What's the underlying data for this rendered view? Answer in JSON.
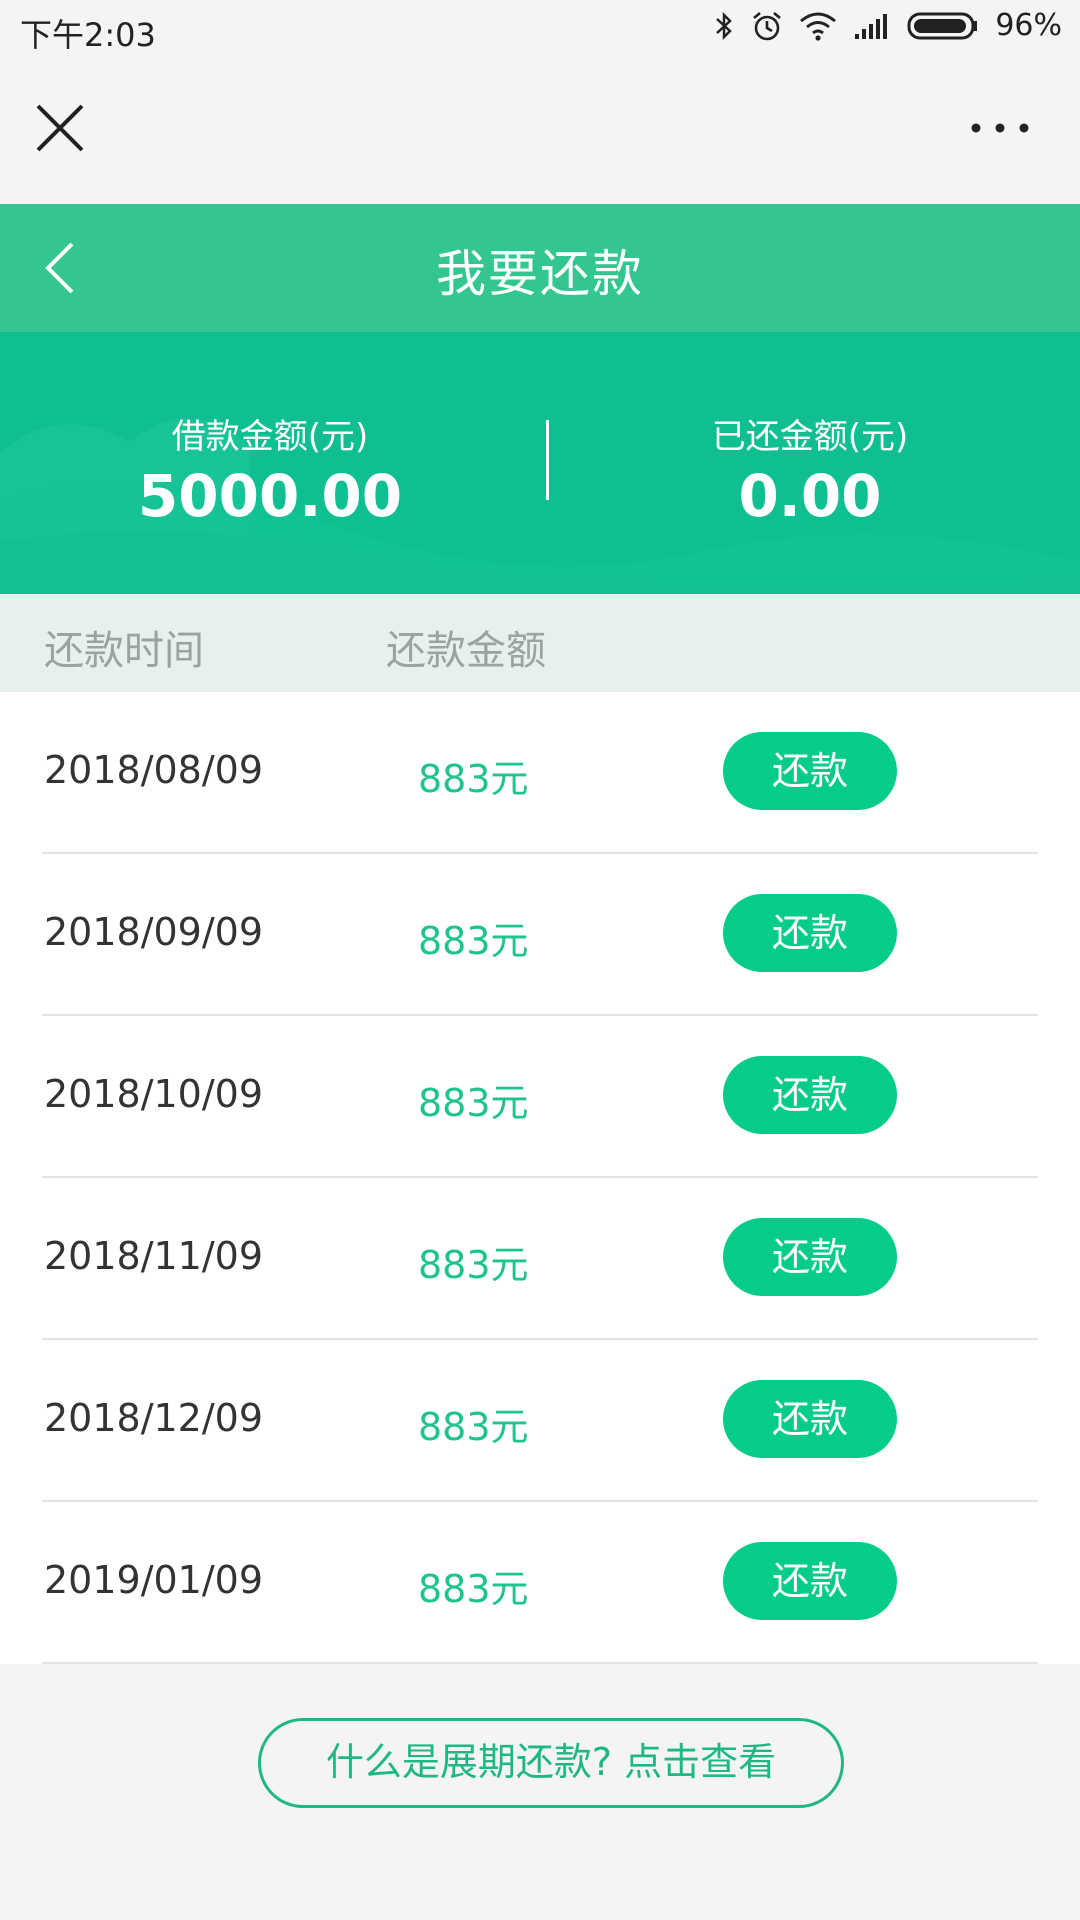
{
  "status_bar": {
    "time": "下午2:03",
    "battery": "96%",
    "icons": [
      "bluetooth-icon",
      "alarm-icon",
      "wifi-icon",
      "signal-icon",
      "battery-icon"
    ]
  },
  "top_bar": {
    "icons": [
      "close-icon",
      "more-icon"
    ]
  },
  "header": {
    "title": "我要还款",
    "loan_label": "借款金额(元)",
    "loan_value": "5000.00",
    "repaid_label": "已还金额(元)",
    "repaid_value": "0.00"
  },
  "columns": {
    "date": "还款时间",
    "amount": "还款金额"
  },
  "rows": [
    {
      "date": "2018/08/09",
      "amount": "883元",
      "button": "还款"
    },
    {
      "date": "2018/09/09",
      "amount": "883元",
      "button": "还款"
    },
    {
      "date": "2018/10/09",
      "amount": "883元",
      "button": "还款"
    },
    {
      "date": "2018/11/09",
      "amount": "883元",
      "button": "还款"
    },
    {
      "date": "2018/12/09",
      "amount": "883元",
      "button": "还款"
    },
    {
      "date": "2019/01/09",
      "amount": "883元",
      "button": "还款"
    }
  ],
  "footer": {
    "link": "什么是展期还款? 点击查看"
  },
  "colors": {
    "brand_green": "#0fbf91",
    "title_bar_green": "#34c691",
    "button_green": "#06cc89",
    "amount_green": "#1fc48c"
  }
}
